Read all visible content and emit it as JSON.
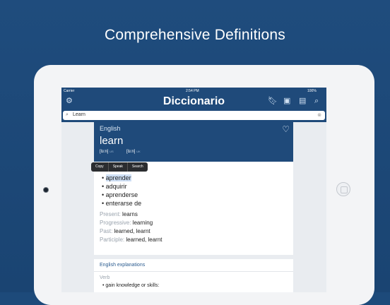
{
  "headline": "Comprehensive Definitions",
  "status": {
    "carrier": "Carrier",
    "time": "2:54 PM",
    "battery": "100%"
  },
  "app": {
    "title": "Diccionario",
    "icons": [
      "gear-icon",
      "bookmark-icon",
      "flashcards-icon",
      "book-icon",
      "search-icon"
    ]
  },
  "search": {
    "value": "Learn"
  },
  "entry": {
    "language": "English",
    "word": "learn",
    "pronunciations": [
      {
        "ipa": "[lɜːn]",
        "region": "US"
      },
      {
        "ipa": "[lɜːn]",
        "region": "UK"
      }
    ],
    "context_menu": [
      "Copy",
      "Speak",
      "Search"
    ],
    "translations": [
      "aprender",
      "adquirir",
      "aprenderse",
      "enterarse de"
    ],
    "forms": [
      {
        "label": "Present:",
        "value": "learns"
      },
      {
        "label": "Progressive:",
        "value": "learning"
      },
      {
        "label": "Past:",
        "value": "learned, learnt"
      },
      {
        "label": "Participle:",
        "value": "learned, learnt"
      }
    ]
  },
  "explanations": {
    "header": "English explanations",
    "pos": "Verb",
    "definition": "gain knowledge or skills:"
  }
}
